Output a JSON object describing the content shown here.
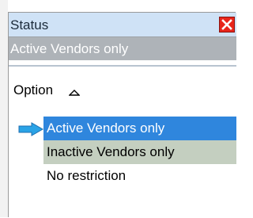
{
  "window": {
    "title": "Status",
    "current_value": "Active Vendors only"
  },
  "list": {
    "column_header": "Option",
    "rows": [
      {
        "label": "Active Vendors only",
        "state": "selected"
      },
      {
        "label": "Inactive Vendors only",
        "state": "hover"
      },
      {
        "label": "No restriction",
        "state": "normal"
      }
    ]
  },
  "colors": {
    "title_bar": "#cfe2f6",
    "close_button": "#e8261c",
    "value_box": "#aeb3b8",
    "selected_row": "#2f86dd",
    "hover_row": "#c4cfc0",
    "arrow": "#2aa3e6"
  },
  "icons": {
    "close": "close-icon",
    "sort": "sort-ascending-icon",
    "current_row": "current-row-arrow-icon"
  }
}
